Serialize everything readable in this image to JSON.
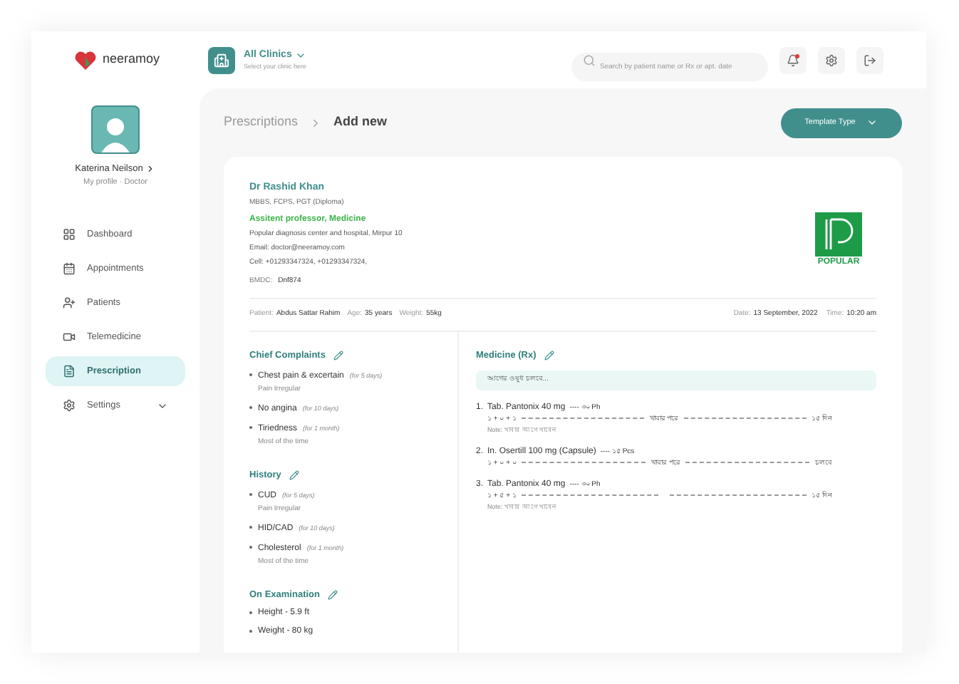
{
  "brand": {
    "name": "neeramoy"
  },
  "clinic": {
    "title": "All Clinics",
    "subtitle": "Select your clinic here"
  },
  "search": {
    "placeholder": "Search by patient name or Rx or apt. date"
  },
  "header_actions": {
    "notification_unread": true
  },
  "profile": {
    "name": "Katerina Neilson",
    "role": "My profile · Doctor"
  },
  "nav": [
    {
      "label": "Dashboard",
      "selected": false,
      "expandable": false
    },
    {
      "label": "Appointments",
      "selected": false,
      "expandable": false
    },
    {
      "label": "Patients",
      "selected": false,
      "expandable": false
    },
    {
      "label": "Telemedicine",
      "selected": false,
      "expandable": false
    },
    {
      "label": "Prescription",
      "selected": true,
      "expandable": false
    },
    {
      "label": "Settings",
      "selected": false,
      "expandable": true
    }
  ],
  "breadcrumb": [
    "Prescriptions",
    "Add new"
  ],
  "template_button": "Template Type",
  "doctor": {
    "name": "Dr Rashid Khan",
    "degrees": "MBBS, FCPS, PGT (Diploma)",
    "title": "Assitent professor, Medicine",
    "lines": [
      "Popular diagnosis center and hospital, Mirpur 10",
      "Email: doctor@neeramoy.com",
      "Cell: +01293347324,  +01293347324,"
    ],
    "bmdc_label": "BMDC:",
    "bmdc_value": "Dnf874"
  },
  "hospital_logo": {
    "caption": "POPULAR"
  },
  "patient": [
    {
      "label": "Patient:",
      "value": "Abdus Sattar Rahim"
    },
    {
      "label": "Age:",
      "value": "35 years"
    },
    {
      "label": "Weight:",
      "value": "55kg"
    }
  ],
  "visit": [
    {
      "label": "Date:",
      "value": "13 September, 2022"
    },
    {
      "label": "Time:",
      "value": "10:20 am"
    }
  ],
  "sections": [
    {
      "title": "Chief Complaints",
      "items": [
        {
          "name": "Chest pain & excertain",
          "duration": "(for 5 days)",
          "note": "Pain Irregular"
        },
        {
          "name": "No angina",
          "duration": "(for 10 days)"
        },
        {
          "name": "Tiriedness",
          "duration": "(for 1 month)",
          "note": "Most of the time"
        }
      ]
    },
    {
      "title": "History",
      "items": [
        {
          "name": "CUD",
          "duration": "(for 5 days)",
          "note": "Pain Irregular"
        },
        {
          "name": "HID/CAD",
          "duration": "(for 10 days)"
        },
        {
          "name": "Cholesterol",
          "duration": "(for 1 month)",
          "note": "Most of the time"
        }
      ]
    },
    {
      "title": "On Examination",
      "items": [
        {
          "name": "Height - 5.9 ft"
        },
        {
          "name": "Weight - 80 kg"
        }
      ]
    }
  ],
  "medicine": {
    "title": "Medicine (Rx)",
    "banner": "আগের ওষুধ চলবে...",
    "items": [
      {
        "number": "1.",
        "name": "Tab.  Pantonix 40 mg",
        "quantity": "---- ৩০ Ph",
        "dose": "১ + ০ + ১",
        "timing": "খাবার পরে",
        "duration": "১৫ দিন",
        "note": "Note: খাবার আগে খাবেন"
      },
      {
        "number": "2.",
        "name": "In.  Osertill 100 mg (Capsule)",
        "quantity": "---- ১৫ Pcs",
        "dose": "১ + ০ + ০",
        "timing": "খাবার পরে",
        "duration": "চলবে"
      },
      {
        "number": "3.",
        "name": "Tab.  Pantonix 40 mg",
        "quantity": "---- ৩০ Ph",
        "dose": "১ + ৫ + ১",
        "duration": "১৫ দিন",
        "note": "Note: খাবার আগে খাবেন"
      }
    ]
  }
}
